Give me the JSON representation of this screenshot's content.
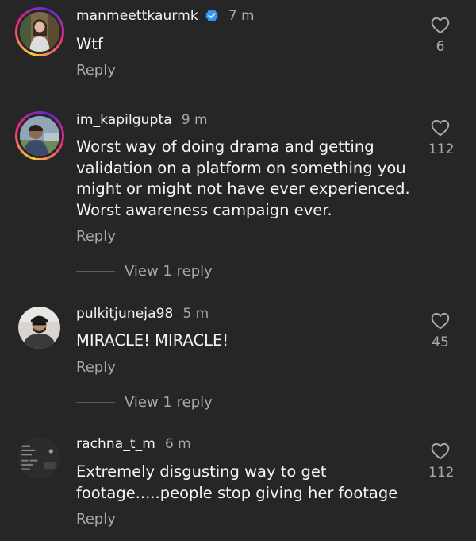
{
  "comments": [
    {
      "username": "manmeettkaurmk",
      "verified": true,
      "time": "7 m",
      "text": "Wtf",
      "reply_label": "Reply",
      "likes": "6"
    },
    {
      "username": "im_kapilgupta",
      "verified": false,
      "time": "9 m",
      "text": "Worst way of doing drama and getting validation on a platform on something you might or might not have ever experienced. Worst awareness campaign ever.",
      "reply_label": "Reply",
      "likes": "112",
      "view_replies_label": "View 1 reply"
    },
    {
      "username": "pulkitjuneja98",
      "verified": false,
      "time": "5 m",
      "text": "MIRACLE! MIRACLE!",
      "reply_label": "Reply",
      "likes": "45",
      "view_replies_label": "View 1 reply"
    },
    {
      "username": "rachna_t_m",
      "verified": false,
      "time": "6 m",
      "text": "Extremely disgusting way to get footage.....people stop giving her footage",
      "reply_label": "Reply",
      "likes": "112"
    }
  ],
  "colors": {
    "background": "#262626",
    "primary_text": "#f5f5f5",
    "secondary_text": "#a8a8a8",
    "verified_blue": "#3897f0"
  },
  "icons": [
    "heart-icon",
    "verified-badge-icon"
  ]
}
